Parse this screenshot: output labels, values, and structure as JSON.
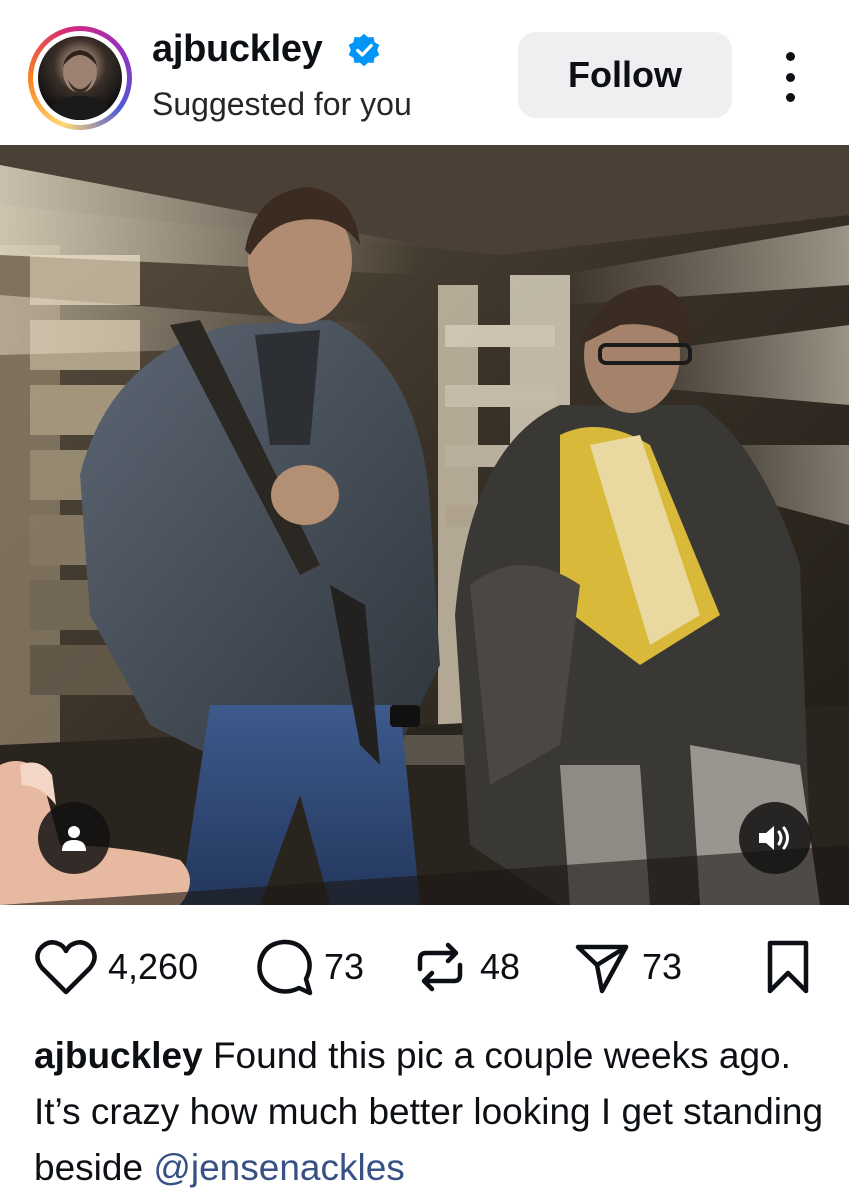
{
  "post": {
    "username": "ajbuckley",
    "verified": true,
    "subtitle": "Suggested for you",
    "follow_label": "Follow",
    "stats": {
      "likes": "4,260",
      "comments": "73",
      "reposts": "48",
      "shares": "73"
    },
    "caption": {
      "username": "ajbuckley",
      "text": "Found this pic a couple weeks ago. It’s crazy  how much better looking I get standing beside ",
      "mention": "@jensenackles"
    }
  },
  "icons": {
    "verified": "verified-badge-icon",
    "more": "more-options-icon",
    "user_tag": "user-tag-icon",
    "sound": "sound-icon",
    "like": "heart-icon",
    "comment": "comment-icon",
    "repost": "repost-icon",
    "share": "share-icon",
    "save": "bookmark-icon"
  },
  "colors": {
    "verified_blue": "#0095f6",
    "follow_bg": "#efeff2",
    "mention": "#385185",
    "text": "#0c1014"
  }
}
